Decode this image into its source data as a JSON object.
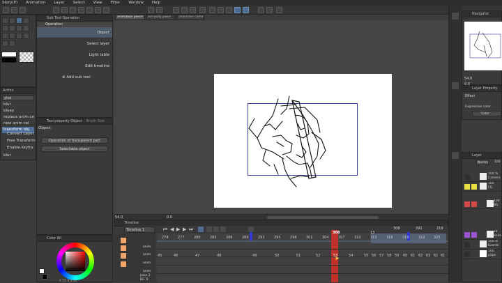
{
  "menu": [
    "Story(P)",
    "Animation",
    "Layer",
    "Select",
    "View",
    "Filter",
    "Window",
    "Help"
  ],
  "tabs": [
    "animation piece!",
    "full body piece",
    "character comm"
  ],
  "sub_tool_header": "Sub Tool Operation",
  "operation_header": "Operation",
  "sub_tools": [
    {
      "label": "Object",
      "selected": true
    },
    {
      "label": "Select layer",
      "selected": false
    },
    {
      "label": "Light table",
      "selected": false
    },
    {
      "label": "Edit timeline",
      "selected": false
    }
  ],
  "add_sub_tool": "Add sub tool",
  "tool_property_header": "Tool property Object",
  "tool_property_header2": "Brush Size",
  "tool_property_title": "Object",
  "operation_transparent": "Operation of transparent part",
  "selectable_object": "Selectable object",
  "tool_options": [
    "Convert Layer",
    "Free Transform",
    "Enable keyfra"
  ],
  "action_header": "Action",
  "action_dropdown": "yive",
  "action_items": [
    {
      "label": "blur",
      "selected": false
    },
    {
      "label": "bluey",
      "selected": false
    },
    {
      "label": "replace anim cel",
      "selected": false
    },
    {
      "label": "new anim cel",
      "selected": false
    },
    {
      "label": "transform obj",
      "selected": true
    }
  ],
  "action_item_bottom": "blur",
  "color_header": "Color Wl",
  "color_value": "0 72 4 0 61",
  "canvas_zoom": "54.0",
  "canvas_angle": "0.0",
  "timeline_header": "Timeline",
  "timeline_name": "Timeline 1",
  "timeline_top_numbers": [
    "308",
    "291",
    "219"
  ],
  "playhead_frame": "308",
  "frame_numbers": [
    "274",
    "277",
    "280",
    "283",
    "286",
    "289",
    "292",
    "295",
    "298",
    "301",
    "304",
    "307",
    "310",
    "313",
    "316",
    "319",
    "322",
    "325"
  ],
  "marker_label": "13",
  "cell_numbers": [
    "45",
    "46",
    "47",
    "48",
    "49",
    "50",
    "51",
    "52",
    "53",
    "54",
    "55",
    "56",
    "57",
    "58",
    "59",
    "60",
    "61",
    "62",
    "63",
    "61",
    "61"
  ],
  "cell_numbers_row2": [
    "55",
    "56",
    "57",
    "58",
    "59",
    "60",
    "61",
    "61"
  ],
  "timeline_rows": [
    "anim",
    "anim",
    "anim",
    "anim",
    "pass 2",
    "BG Tr"
  ],
  "navigator_header": "Navigator",
  "nav_zoom": "54.0",
  "nav_angle": "0.0",
  "layer_property_header": "Layer Property",
  "effect_label": "Effect",
  "expression_color_label": "Expression color",
  "color_mode": "Color",
  "layer_header": "Layer",
  "blend_mode": "Norma",
  "opacity": "100",
  "layers": [
    {
      "line1": "100 %",
      "line2": "Camera"
    },
    {
      "line1": "100",
      "line2": "FG"
    },
    {
      "line1": "100",
      "line2": "BG"
    },
    {
      "line1": "14",
      "line2": "anim"
    },
    {
      "line1": "100 %",
      "line2": "boards"
    },
    {
      "line1": "100",
      "line2": "pape"
    }
  ]
}
